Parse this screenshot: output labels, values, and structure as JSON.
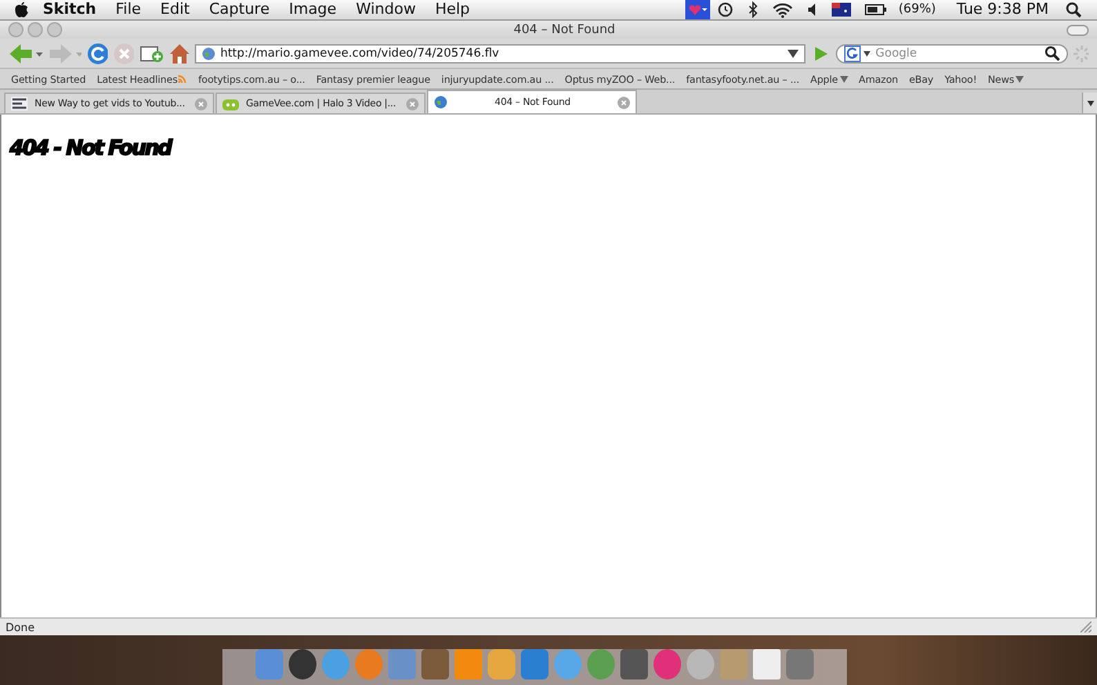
{
  "menu_bar": {
    "app_name": "Skitch",
    "menus": [
      "File",
      "Edit",
      "Capture",
      "Image",
      "Window",
      "Help"
    ],
    "battery": "(69%)",
    "clock": "Tue 9:38 PM"
  },
  "window": {
    "title": "404 – Not Found",
    "toolbar": {
      "url": "http://mario.gamevee.com/video/74/205746.flv",
      "search_placeholder": "Google"
    },
    "bookmarks": [
      {
        "label": "Getting Started",
        "kind": "link"
      },
      {
        "label": "Latest Headlines",
        "kind": "feed"
      },
      {
        "label": "footytips.com.au – o...",
        "kind": "link"
      },
      {
        "label": "Fantasy premier league",
        "kind": "link"
      },
      {
        "label": "injuryupdate.com.au ...",
        "kind": "link"
      },
      {
        "label": "Optus myZOO – Web...",
        "kind": "link"
      },
      {
        "label": "fantasyfooty.net.au – ...",
        "kind": "link"
      },
      {
        "label": "Apple",
        "kind": "menu"
      },
      {
        "label": "Amazon",
        "kind": "link"
      },
      {
        "label": "eBay",
        "kind": "link"
      },
      {
        "label": "Yahoo!",
        "kind": "link"
      },
      {
        "label": "News",
        "kind": "menu"
      }
    ],
    "tabs": [
      {
        "title": "New Way to get vids to Youtub...",
        "selected": false
      },
      {
        "title": "GameVee.com | Halo 3 Video |...",
        "selected": false
      },
      {
        "title": "404 – Not Found",
        "selected": true
      }
    ],
    "page": {
      "heading": "404 - Not Found"
    },
    "status_bar": "Done"
  }
}
